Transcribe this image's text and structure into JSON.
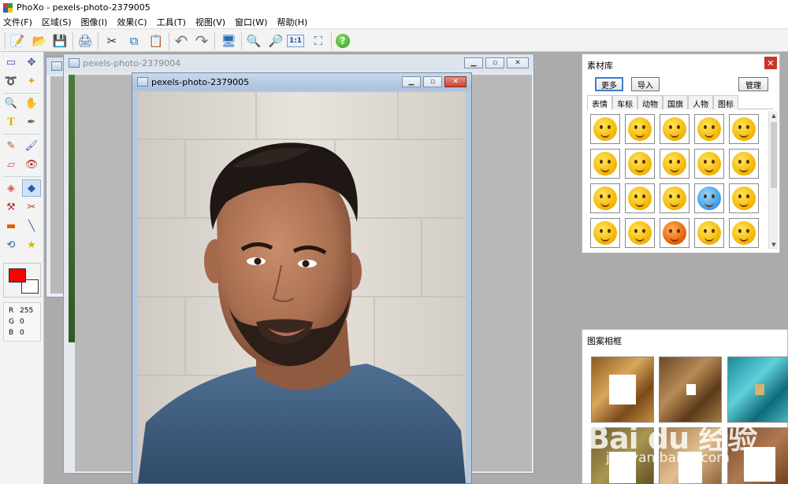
{
  "window": {
    "title": "PhoXo - pexels-photo-2379005"
  },
  "menu": [
    "文件(F)",
    "区域(S)",
    "图像(I)",
    "效果(C)",
    "工具(T)",
    "视图(V)",
    "窗口(W)",
    "帮助(H)"
  ],
  "toolbar": {
    "buttons": [
      {
        "name": "new-icon",
        "glyph": "📝"
      },
      {
        "name": "open-icon",
        "glyph": "📂"
      },
      {
        "name": "save-icon",
        "glyph": "💾"
      },
      {
        "name": "print-icon",
        "glyph": "🖨"
      },
      {
        "name": "cut-icon",
        "glyph": "✂"
      },
      {
        "name": "copy-icon",
        "glyph": "⧉"
      },
      {
        "name": "paste-icon",
        "glyph": "📋"
      },
      {
        "name": "undo-icon",
        "glyph": "↶"
      },
      {
        "name": "redo-icon",
        "glyph": "↷"
      },
      {
        "name": "screen-capture-icon",
        "glyph": "🖥"
      },
      {
        "name": "zoom-in-icon",
        "glyph": "🔍"
      },
      {
        "name": "zoom-out-icon",
        "glyph": "🔎"
      },
      {
        "name": "actual-size-icon",
        "glyph": "1:1"
      },
      {
        "name": "fit-window-icon",
        "glyph": "⛶"
      },
      {
        "name": "help-icon",
        "glyph": "?"
      }
    ]
  },
  "tools": [
    {
      "name": "rect-select-icon",
      "glyph": "▭"
    },
    {
      "name": "move-icon",
      "glyph": "✥"
    },
    {
      "name": "lasso-icon",
      "glyph": "➰"
    },
    {
      "name": "magic-wand-icon",
      "glyph": "✦"
    },
    {
      "name": "zoom-tool-icon",
      "glyph": "🔍"
    },
    {
      "name": "hand-icon",
      "glyph": "✋"
    },
    {
      "name": "text-tool-icon",
      "glyph": "T"
    },
    {
      "name": "eyedropper-icon",
      "glyph": "✒"
    },
    {
      "name": "pencil-icon",
      "glyph": "✎"
    },
    {
      "name": "brush-icon",
      "glyph": "🖌"
    },
    {
      "name": "eraser-icon",
      "glyph": "▱"
    },
    {
      "name": "red-eye-icon",
      "glyph": "👁"
    },
    {
      "name": "fill-icon",
      "glyph": "◈"
    },
    {
      "name": "material-icon",
      "glyph": "◆"
    },
    {
      "name": "stamp-icon",
      "glyph": "⚒"
    },
    {
      "name": "scissors-tool-icon",
      "glyph": "✂"
    },
    {
      "name": "gradient-icon",
      "glyph": "▬"
    },
    {
      "name": "line-icon",
      "glyph": "╲"
    },
    {
      "name": "transform-icon",
      "glyph": "⟲"
    },
    {
      "name": "shape-icon",
      "glyph": "★"
    }
  ],
  "colors": {
    "foreground": "#ff0000",
    "background": "#ffffff"
  },
  "rgb": [
    {
      "k": "R",
      "v": "255"
    },
    {
      "k": "G",
      "v": "0"
    },
    {
      "k": "B",
      "v": "0"
    }
  ],
  "documents": {
    "back": "",
    "middle": "pexels-photo-2379004",
    "front": "pexels-photo-2379005"
  },
  "material_panel": {
    "title": "素材库",
    "buttons": {
      "more": "更多",
      "import": "导入",
      "manage": "管理"
    },
    "tabs": [
      "表情",
      "车标",
      "动物",
      "国旗",
      "人物",
      "图标"
    ],
    "active_tab": "表情"
  },
  "frames_panel": {
    "title": "图案相框"
  },
  "watermark": {
    "brand": "Bai du 经验",
    "url": "jingyan.baidu.com"
  }
}
